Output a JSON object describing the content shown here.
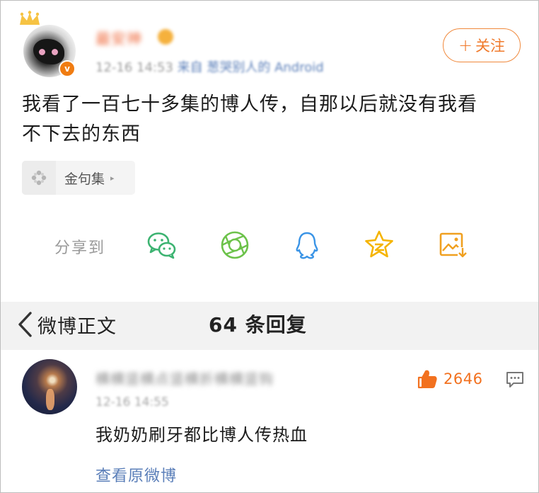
{
  "post": {
    "username": "最安神",
    "timestamp": "12-16 14:53",
    "source": "来自 葱哭别人的 Android",
    "follow_label": "关注",
    "follow_plus": "+",
    "text": "我看了一百七十多集的博人传，自那以后就没有我看不下去的东西",
    "topic_label": "金句集",
    "topic_arrow": "▸",
    "share_label": "分享到",
    "share_targets": [
      "wechat-icon",
      "moments-icon",
      "qq-icon",
      "qzone-icon",
      "save-image-icon"
    ],
    "accent_color": "#f07a2b",
    "verified_badge_text": "v"
  },
  "navbar": {
    "back_label": "微博正文",
    "title": "64 条回复"
  },
  "comment": {
    "username": "横横竖横点竖横折横横竖钩",
    "timestamp": "12-16 14:55",
    "text": "我奶奶刷牙都比博人传热血",
    "like_count": "2646",
    "link_label": "查看原微博",
    "link_color": "#5b7fb9",
    "like_color": "#f2711f"
  }
}
